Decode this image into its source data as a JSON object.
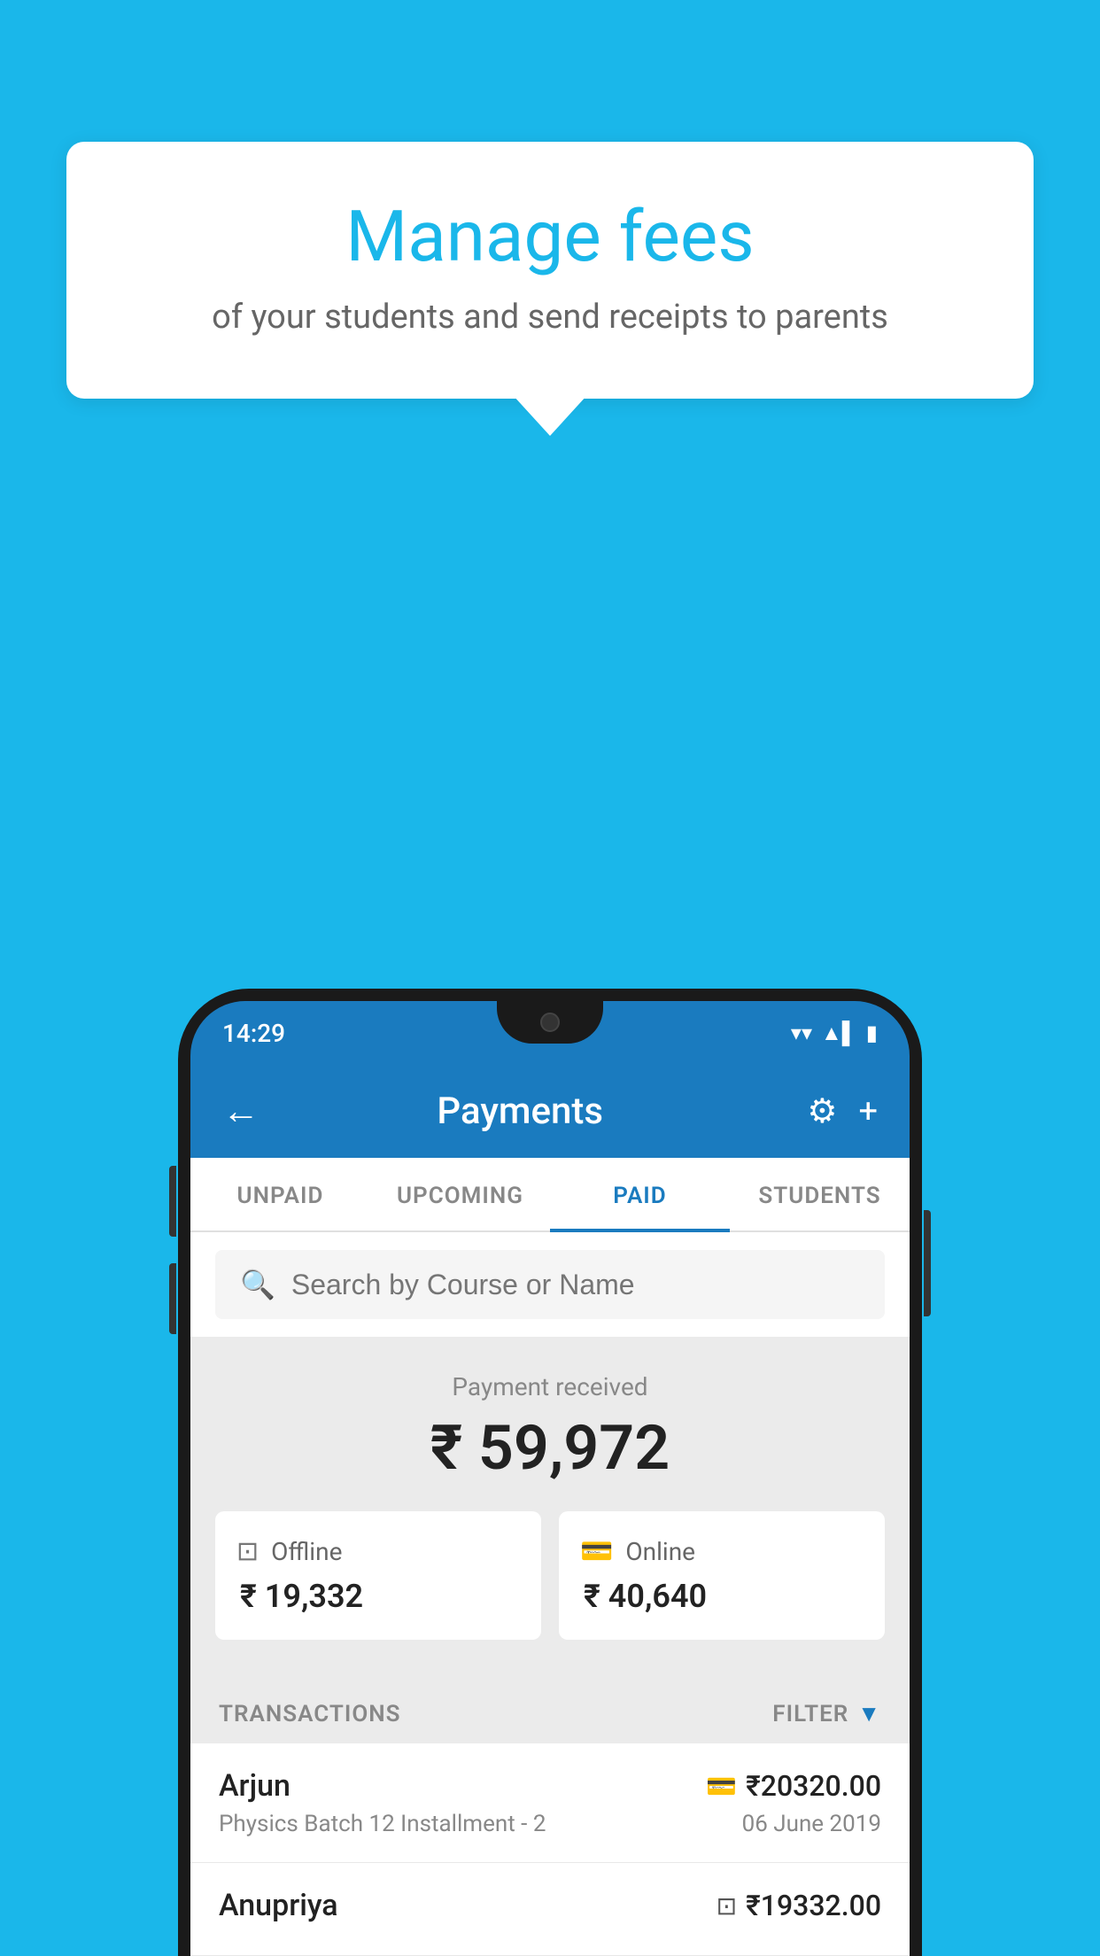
{
  "background_color": "#1ab7ea",
  "bubble": {
    "title": "Manage fees",
    "subtitle": "of your students and send receipts to parents"
  },
  "phone": {
    "status_bar": {
      "time": "14:29",
      "wifi": "▼",
      "signal": "▲",
      "battery": "▮"
    },
    "app_bar": {
      "title": "Payments",
      "back_label": "←",
      "settings_label": "⚙",
      "add_label": "+"
    },
    "tabs": [
      {
        "label": "UNPAID",
        "active": false
      },
      {
        "label": "UPCOMING",
        "active": false
      },
      {
        "label": "PAID",
        "active": true
      },
      {
        "label": "STUDENTS",
        "active": false
      }
    ],
    "search": {
      "placeholder": "Search by Course or Name"
    },
    "payment_summary": {
      "label": "Payment received",
      "amount": "₹ 59,972",
      "offline": {
        "label": "Offline",
        "amount": "₹ 19,332"
      },
      "online": {
        "label": "Online",
        "amount": "₹ 40,640"
      }
    },
    "transactions": {
      "header_label": "TRANSACTIONS",
      "filter_label": "FILTER",
      "items": [
        {
          "name": "Arjun",
          "course": "Physics Batch 12 Installment - 2",
          "amount": "₹20320.00",
          "date": "06 June 2019",
          "payment_type": "online"
        },
        {
          "name": "Anupriya",
          "course": "",
          "amount": "₹19332.00",
          "date": "",
          "payment_type": "offline"
        }
      ]
    }
  }
}
